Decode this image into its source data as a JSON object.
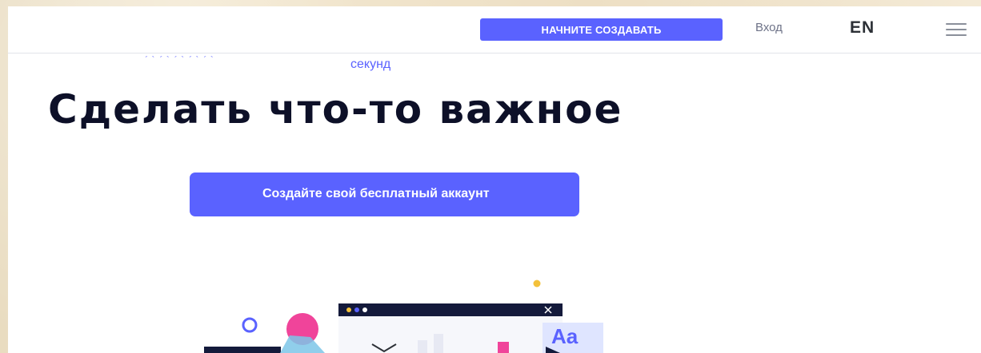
{
  "header": {
    "cta_label": "НАЧНИТЕ СОЗДАВАТЬ",
    "login_label": "Вход",
    "language": "EN",
    "menu_icon": "hamburger-icon"
  },
  "hero": {
    "subtitle_fragment": "секунд",
    "headline": "Сделать что-то важное",
    "cta_label": "Создайте свой бесплатный аккаунт"
  },
  "illustration": {
    "text_style_badge": "Aa",
    "colors": {
      "accent": "#5a62ff",
      "pink": "#f0449a",
      "yellow": "#f3c13a",
      "navy": "#141a3b",
      "badge_bg": "#dfe5ff"
    }
  }
}
